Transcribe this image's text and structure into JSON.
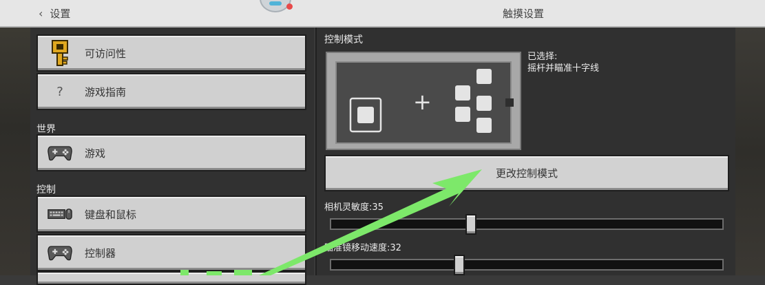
{
  "header": {
    "back_label": "设置",
    "title": "触摸设置"
  },
  "sidebar": {
    "items": [
      {
        "label": "可访问性",
        "icon": "key-icon"
      },
      {
        "label": "游戏指南",
        "icon": "question-icon",
        "glyph": "?"
      }
    ],
    "sections": [
      {
        "label": "世界",
        "items": [
          {
            "label": "游戏",
            "icon": "gamepad-icon"
          }
        ]
      },
      {
        "label": "控制",
        "items": [
          {
            "label": "键盘和鼠标",
            "icon": "keyboard-mouse-icon"
          },
          {
            "label": "控制器",
            "icon": "gamepad-icon"
          }
        ]
      }
    ]
  },
  "main": {
    "section_title": "控制模式",
    "selected_label": "已选择:",
    "selected_value": "摇杆并瞄准十字线",
    "preview_glyph": "+",
    "change_button": "更改控制模式",
    "sliders": [
      {
        "label": "相机灵敏度:35",
        "value": 35
      },
      {
        "label": "瞄准镜移动速度:32",
        "value": 32
      }
    ]
  },
  "colors": {
    "annotation_arrow": "#7de86a",
    "notification_dot": "#e84a4a"
  }
}
